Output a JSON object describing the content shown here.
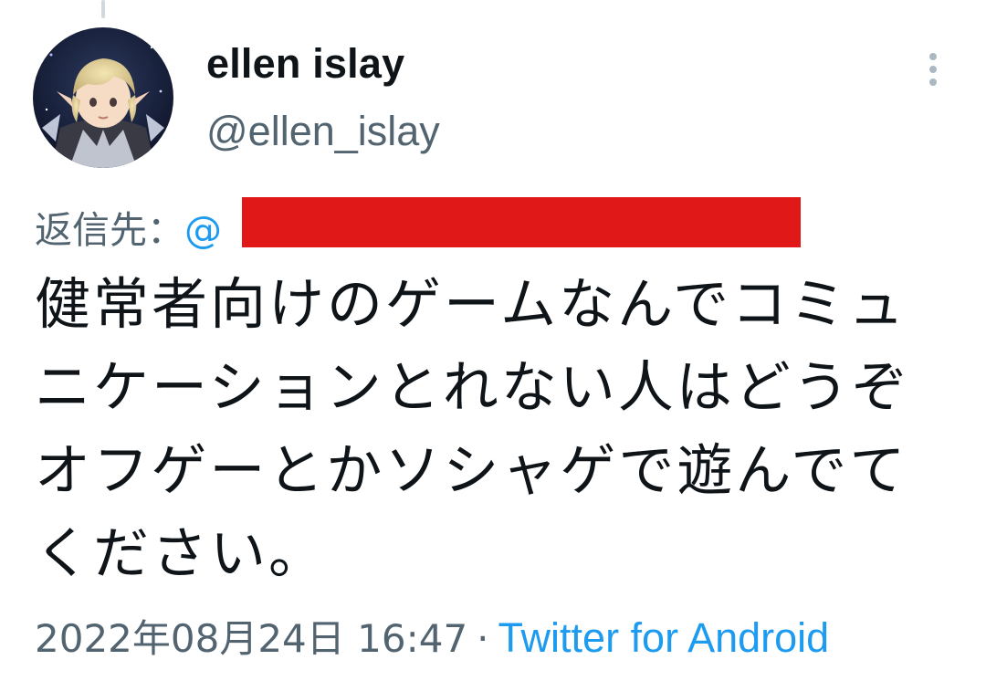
{
  "tweet": {
    "display_name": "ellen islay",
    "handle": "@ellen_islay",
    "reply_label": "返信先：",
    "reply_at": "@",
    "text": "健常者向けのゲームなんでコミュニケーションとれない人はどうぞオフゲーとかソシャゲで遊んでてください。",
    "timestamp": "2022年08月24日 16:47",
    "separator": "·",
    "source": "Twitter for Android"
  },
  "icons": {
    "more": "more-vertical-icon",
    "avatar": "avatar-image"
  },
  "colors": {
    "link": "#1d9bf0",
    "secondary_text": "#536471",
    "primary_text": "#0f1419",
    "redaction": "#e11818"
  }
}
